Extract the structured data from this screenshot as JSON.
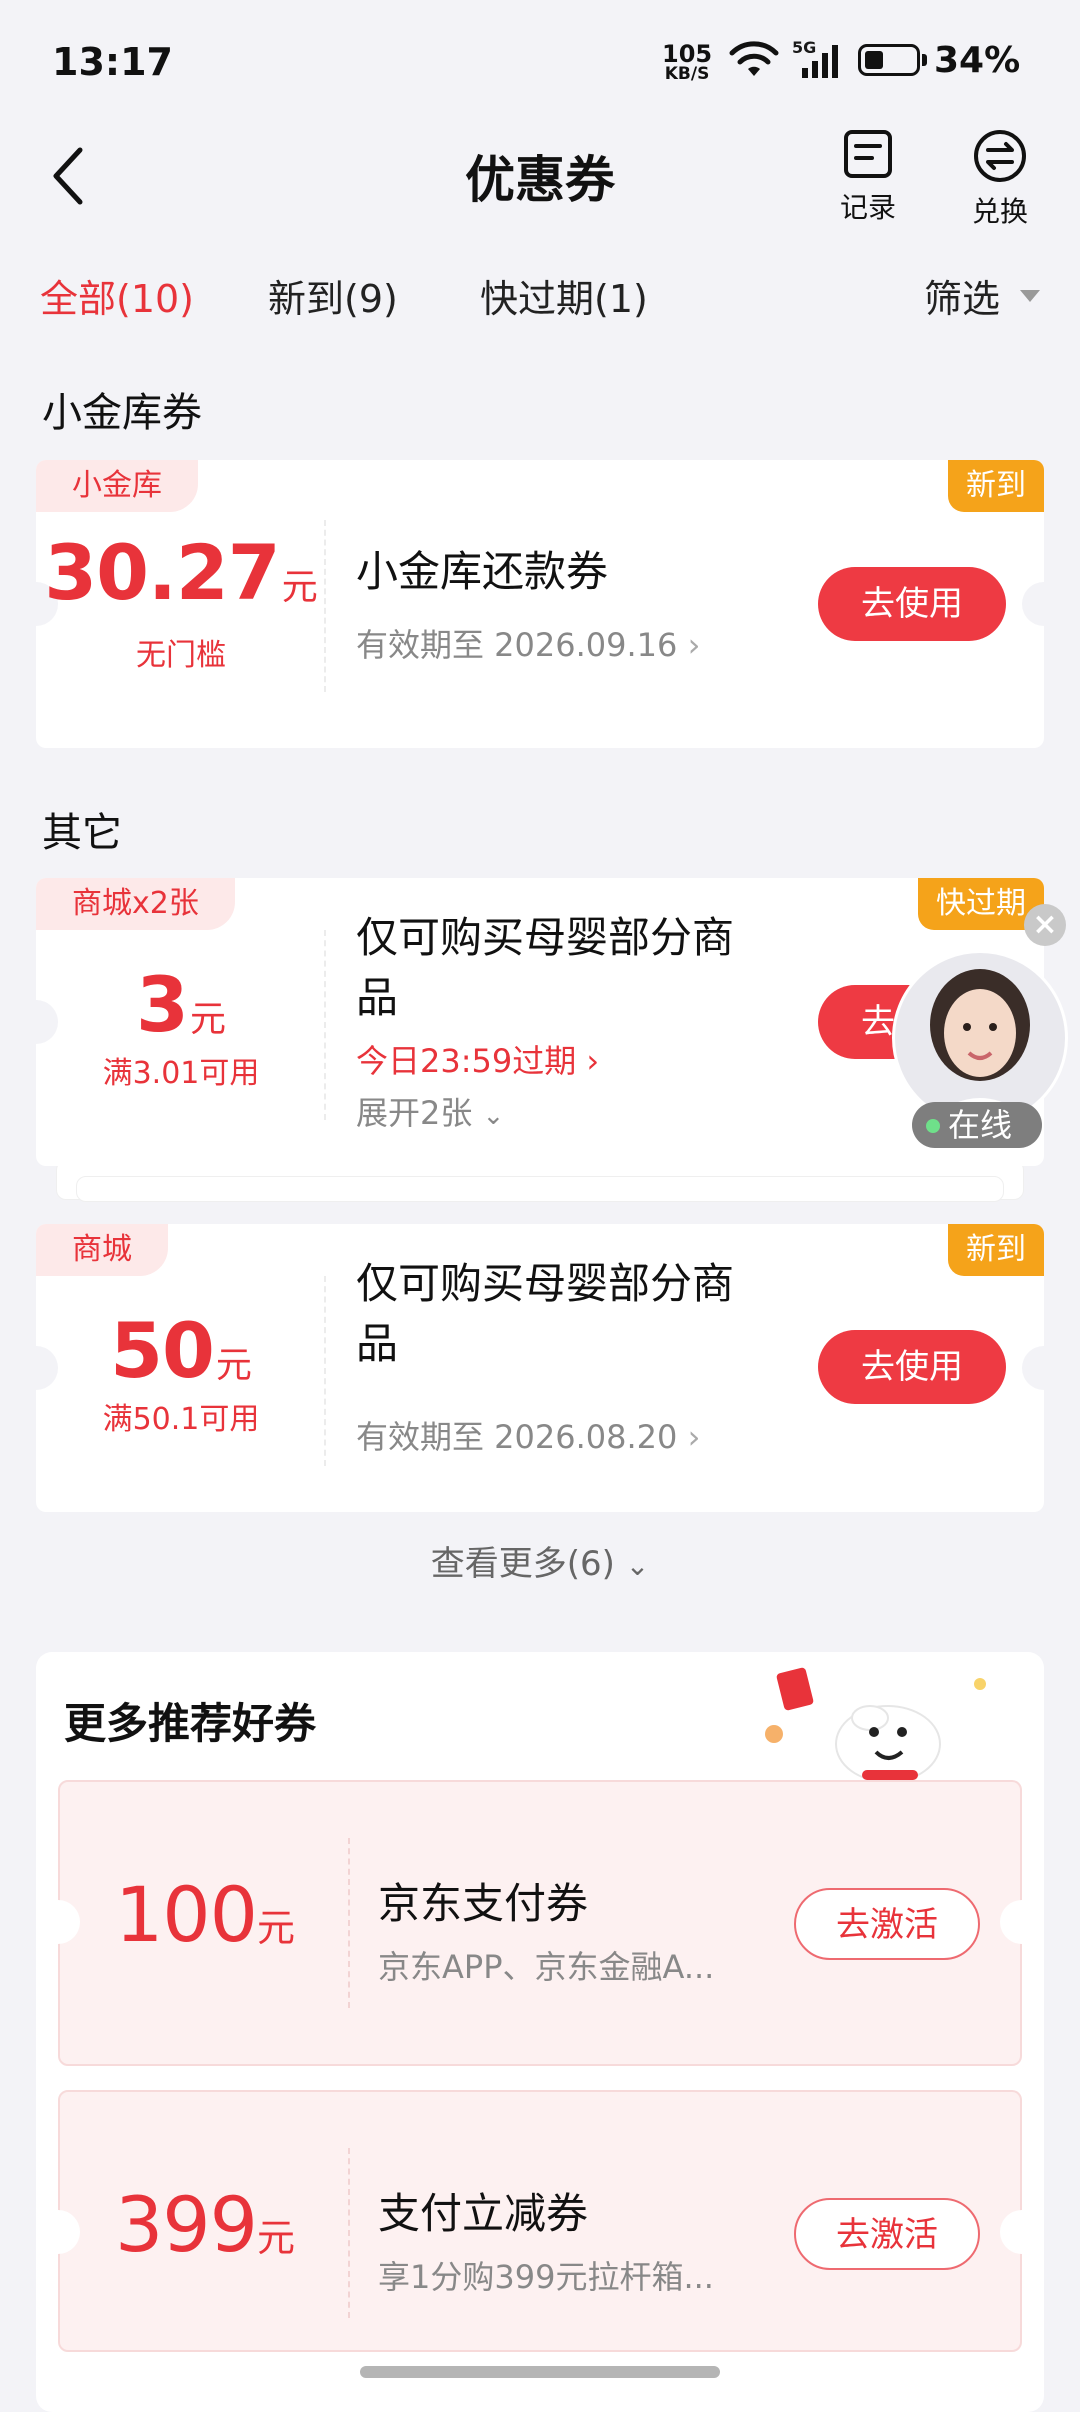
{
  "status_bar": {
    "time": "13:17",
    "net_speed_value": "105",
    "net_speed_unit": "KB/S",
    "network": "5G",
    "battery": "34%"
  },
  "header": {
    "title": "优惠券",
    "records_label": "记录",
    "exchange_label": "兑换"
  },
  "tabs": [
    {
      "label": "全部(10)",
      "active": true
    },
    {
      "label": "新到(9)",
      "active": false
    },
    {
      "label": "快过期(1)",
      "active": false
    }
  ],
  "filter_label": "筛选",
  "sections": {
    "vault_title": "小金库券",
    "others_title": "其它"
  },
  "coupons": [
    {
      "tag": "小金库",
      "badge": "新到",
      "amount": "30.27",
      "unit": "元",
      "condition": "无门槛",
      "name": "小金库还款券",
      "validity": "有效期至 2026.09.16",
      "button": "去使用"
    },
    {
      "tag": "商城x2张",
      "badge": "快过期",
      "amount": "3",
      "unit": "元",
      "condition": "满3.01可用",
      "name_line1": "仅可购买母婴部分商",
      "name_line2": "品",
      "validity": "今日23:59过期",
      "expand": "展开2张",
      "button": "去使用"
    },
    {
      "tag": "商城",
      "badge": "新到",
      "amount": "50",
      "unit": "元",
      "condition": "满50.1可用",
      "name_line1": "仅可购买母婴部分商",
      "name_line2": "品",
      "validity": "有效期至 2026.08.20",
      "button": "去使用"
    }
  ],
  "see_more": "查看更多(6)",
  "recommend": {
    "title": "更多推荐好券",
    "items": [
      {
        "amount": "100",
        "unit": "元",
        "name": "京东支付券",
        "desc": "京东APP、京东金融A...",
        "button": "去激活"
      },
      {
        "amount": "399",
        "unit": "元",
        "name": "支付立减券",
        "desc": "享1分购399元拉杆箱...",
        "button": "去激活"
      }
    ]
  },
  "floating_agent": {
    "status": "在线",
    "close": "×"
  },
  "colors": {
    "accent": "#e8333a",
    "badge_orange": "#f5a31a",
    "background": "#f3f3f7"
  }
}
